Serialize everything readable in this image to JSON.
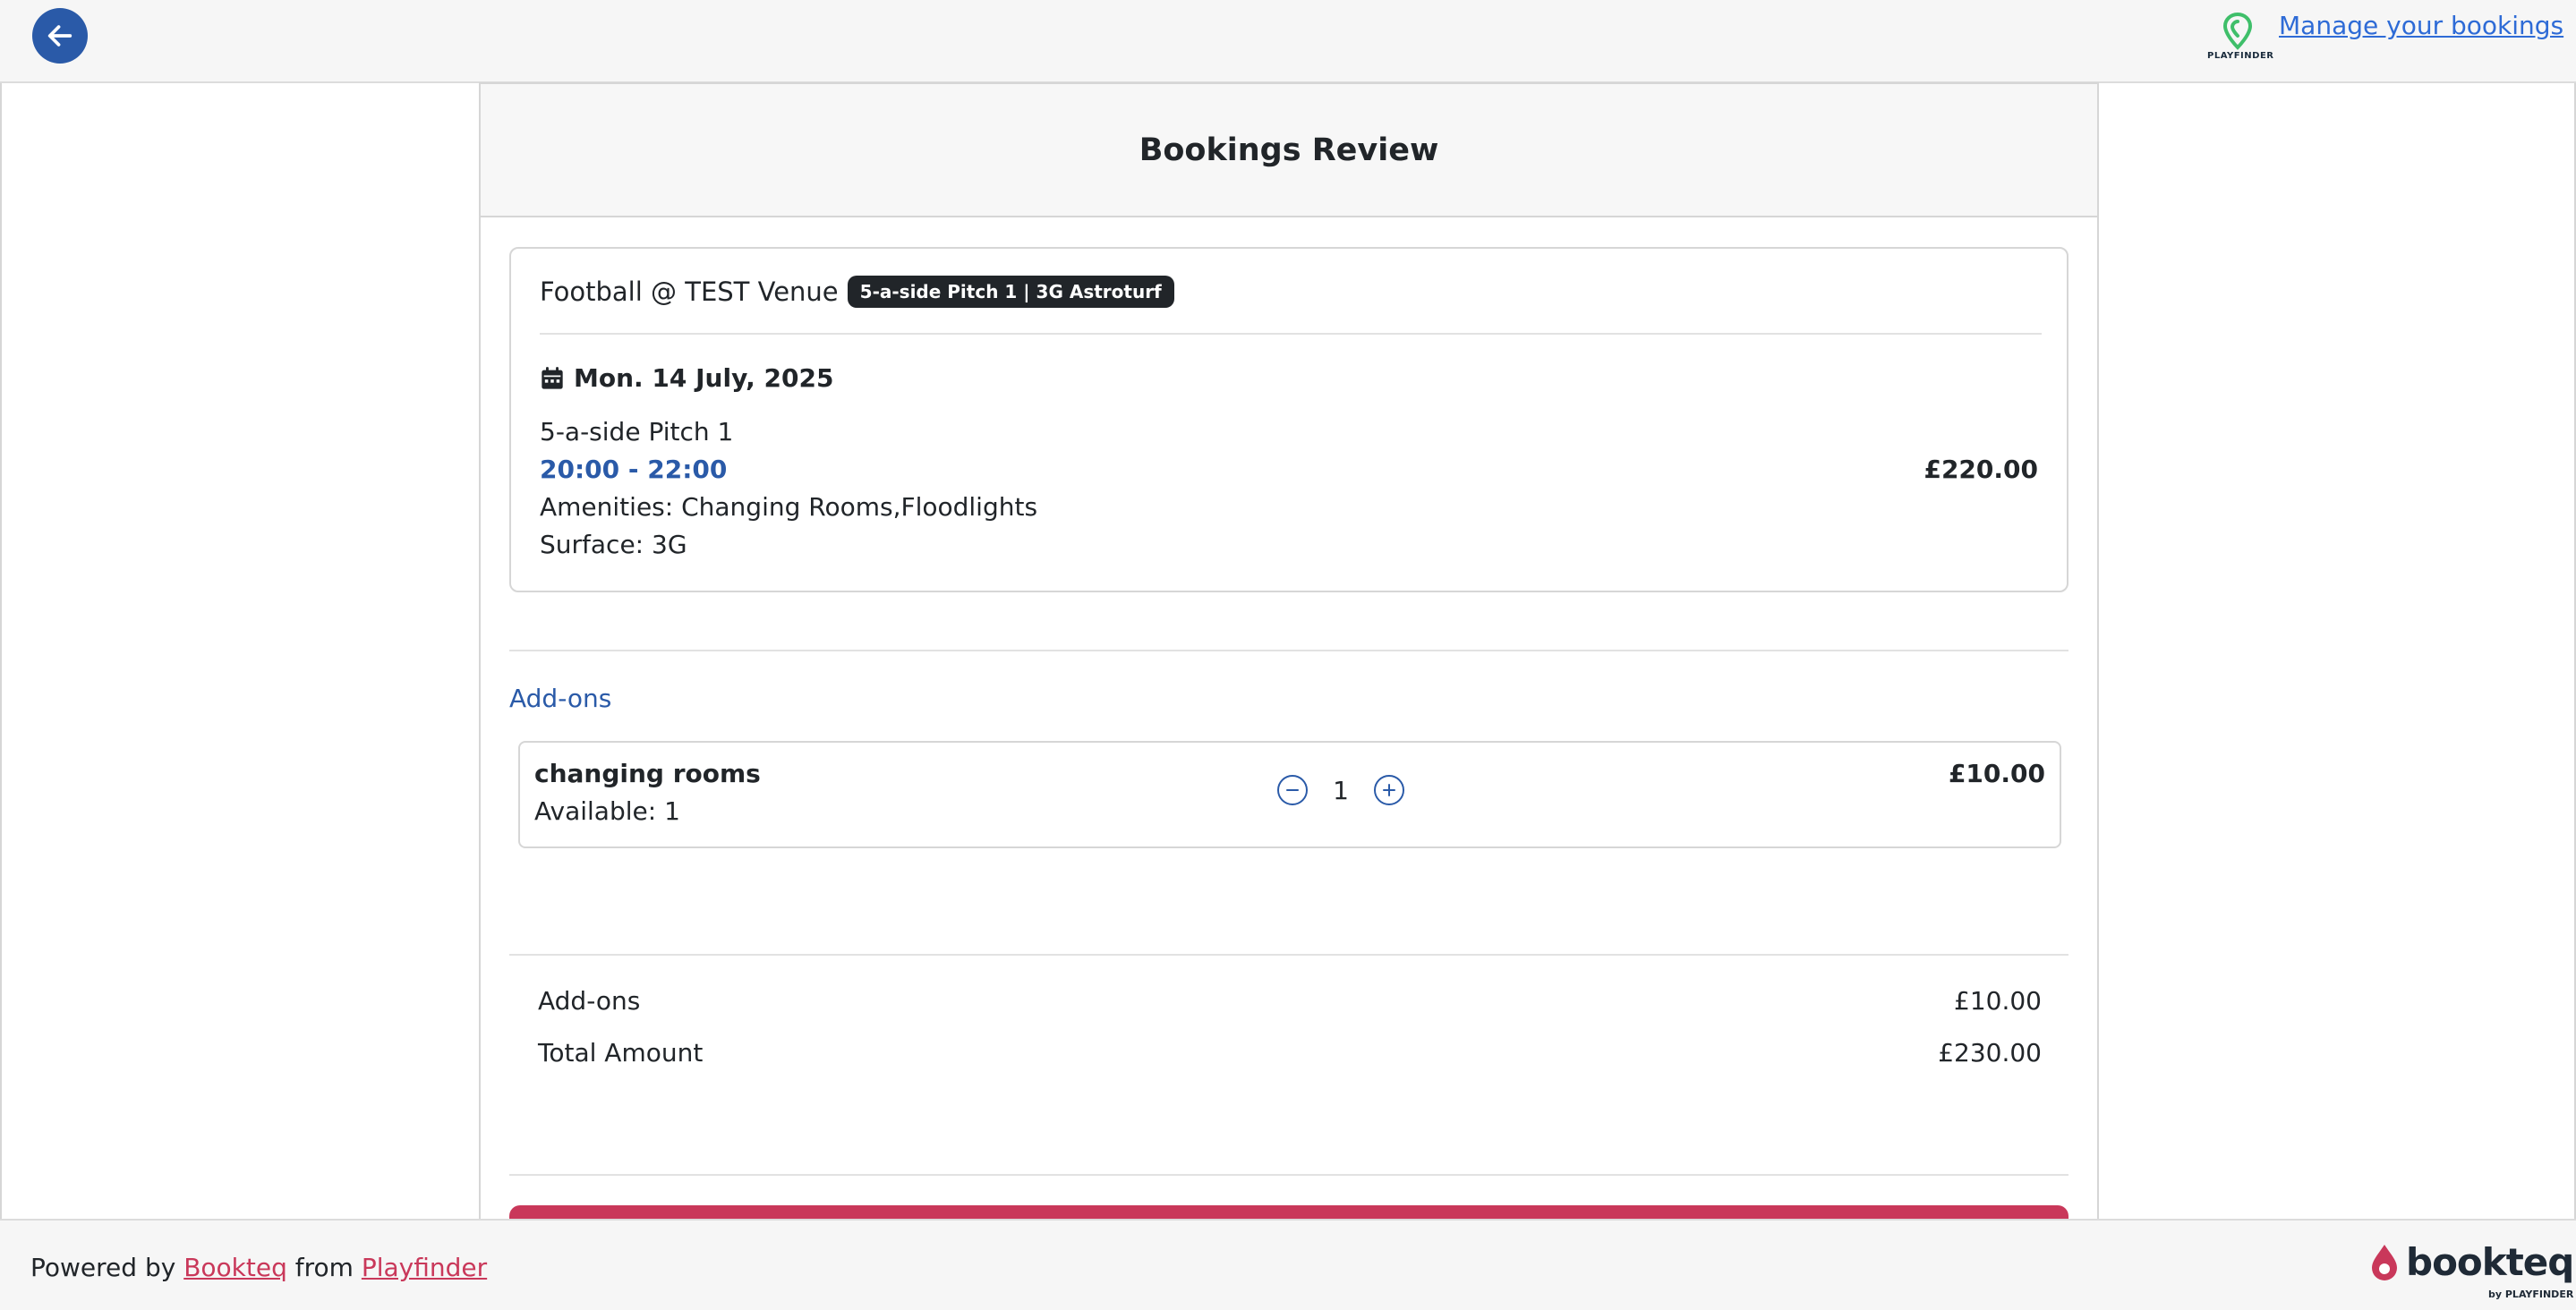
{
  "header": {
    "manage_link": "Manage your bookings",
    "logo_text": "PLAYFINDER"
  },
  "review": {
    "title": "Bookings Review",
    "venue": "Football @ TEST Venue",
    "pitch_badge": "5-a-side Pitch 1 | 3G Astroturf",
    "date": "Mon. 14 July, 2025",
    "pitch_name": "5-a-side Pitch 1",
    "time_range": "20:00 - 22:00",
    "amenities": "Amenities:  Changing Rooms,Floodlights",
    "surface": "Surface:  3G",
    "price": "£220.00"
  },
  "addons": {
    "heading": "Add-ons",
    "items": [
      {
        "name": "changing rooms",
        "available": "Available: 1",
        "quantity": "1",
        "price": "£10.00"
      }
    ]
  },
  "summary": {
    "addons_label": "Add-ons",
    "addons_value": "£10.00",
    "total_label": "Total Amount",
    "total_value": "£230.00"
  },
  "footer": {
    "powered_by": "Powered by",
    "bookteq_link": "Bookteq",
    "from": "from",
    "playfinder_link": "Playfinder",
    "brand": "bookteq",
    "brand_sub": "by PLAYFINDER"
  },
  "colors": {
    "primary_blue": "#2a5aa8",
    "link_blue": "#2e6bd6",
    "accent_red": "#c9385a",
    "playfinder_green": "#3fbf6a"
  }
}
